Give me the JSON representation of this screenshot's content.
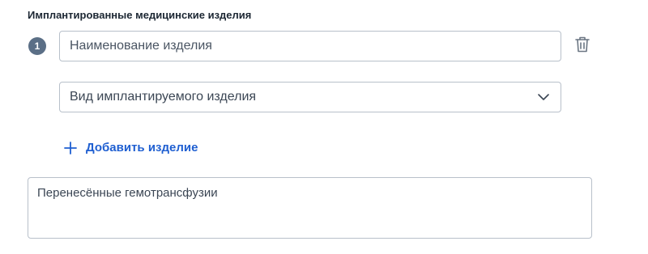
{
  "section": {
    "title": "Имплантированные медицинские изделия"
  },
  "items": [
    {
      "index": "1",
      "name_placeholder": "Наименование изделия",
      "type_select_value": "Вид имплантируемого изделия"
    }
  ],
  "actions": {
    "add_item_label": "Добавить изделие"
  },
  "transfusions": {
    "placeholder": "Перенесённые гемотрансфузии"
  },
  "icons": {
    "delete": "trash-icon",
    "dropdown": "chevron-down-icon",
    "add": "plus-icon"
  },
  "colors": {
    "accent": "#1f5fd1",
    "badge": "#5b6f86",
    "border": "#b8c0ca"
  }
}
